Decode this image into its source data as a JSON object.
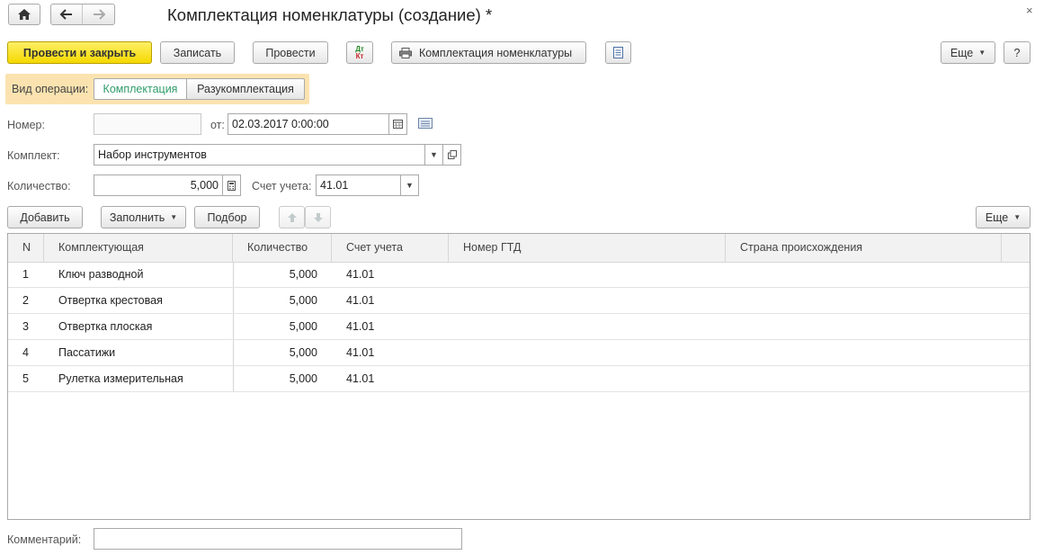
{
  "window": {
    "title": "Комплектация номенклатуры (создание) *",
    "close_glyph": "×"
  },
  "nav": {
    "home_icon": "home-icon",
    "back_icon": "arrow-left-icon",
    "forward_icon": "arrow-right-icon"
  },
  "toolbar": {
    "post_and_close": "Провести и закрыть",
    "save": "Записать",
    "post": "Провести",
    "dt_kt_top": "Дт",
    "dt_kt_bottom": "Кт",
    "print_label": "Комплектация номенклатуры",
    "more": "Еще",
    "help": "?"
  },
  "operation": {
    "label": "Вид операции:",
    "options": [
      "Комплектация",
      "Разукомплектация"
    ],
    "selected": "Комплектация"
  },
  "form": {
    "number_label": "Номер:",
    "number_value": "",
    "date_label": "от:",
    "date_value": "02.03.2017  0:00:00",
    "kit_label": "Комплект:",
    "kit_value": "Набор инструментов",
    "qty_label": "Количество:",
    "qty_value": "5,000",
    "account_label": "Счет учета:",
    "account_value": "41.01",
    "comment_label": "Комментарий:",
    "comment_value": ""
  },
  "table_toolbar": {
    "add": "Добавить",
    "fill": "Заполнить",
    "pick": "Подбор",
    "more": "Еще"
  },
  "table": {
    "columns": [
      "N",
      "Комплектующая",
      "Количество",
      "Счет учета",
      "Номер ГТД",
      "Страна происхождения"
    ],
    "rows": [
      {
        "n": "1",
        "item": "Ключ разводной",
        "qty": "5,000",
        "account": "41.01",
        "gtd": "",
        "country": ""
      },
      {
        "n": "2",
        "item": "Отвертка крестовая",
        "qty": "5,000",
        "account": "41.01",
        "gtd": "",
        "country": ""
      },
      {
        "n": "3",
        "item": "Отвертка плоская",
        "qty": "5,000",
        "account": "41.01",
        "gtd": "",
        "country": ""
      },
      {
        "n": "4",
        "item": "Пассатижи",
        "qty": "5,000",
        "account": "41.01",
        "gtd": "",
        "country": ""
      },
      {
        "n": "5",
        "item": "Рулетка измерительная",
        "qty": "5,000",
        "account": "41.01",
        "gtd": "",
        "country": ""
      }
    ]
  },
  "colors": {
    "primary_button": "#f5d800",
    "operation_highlight": "#fbe3b0",
    "selected_option_text": "#2e9c6a"
  }
}
